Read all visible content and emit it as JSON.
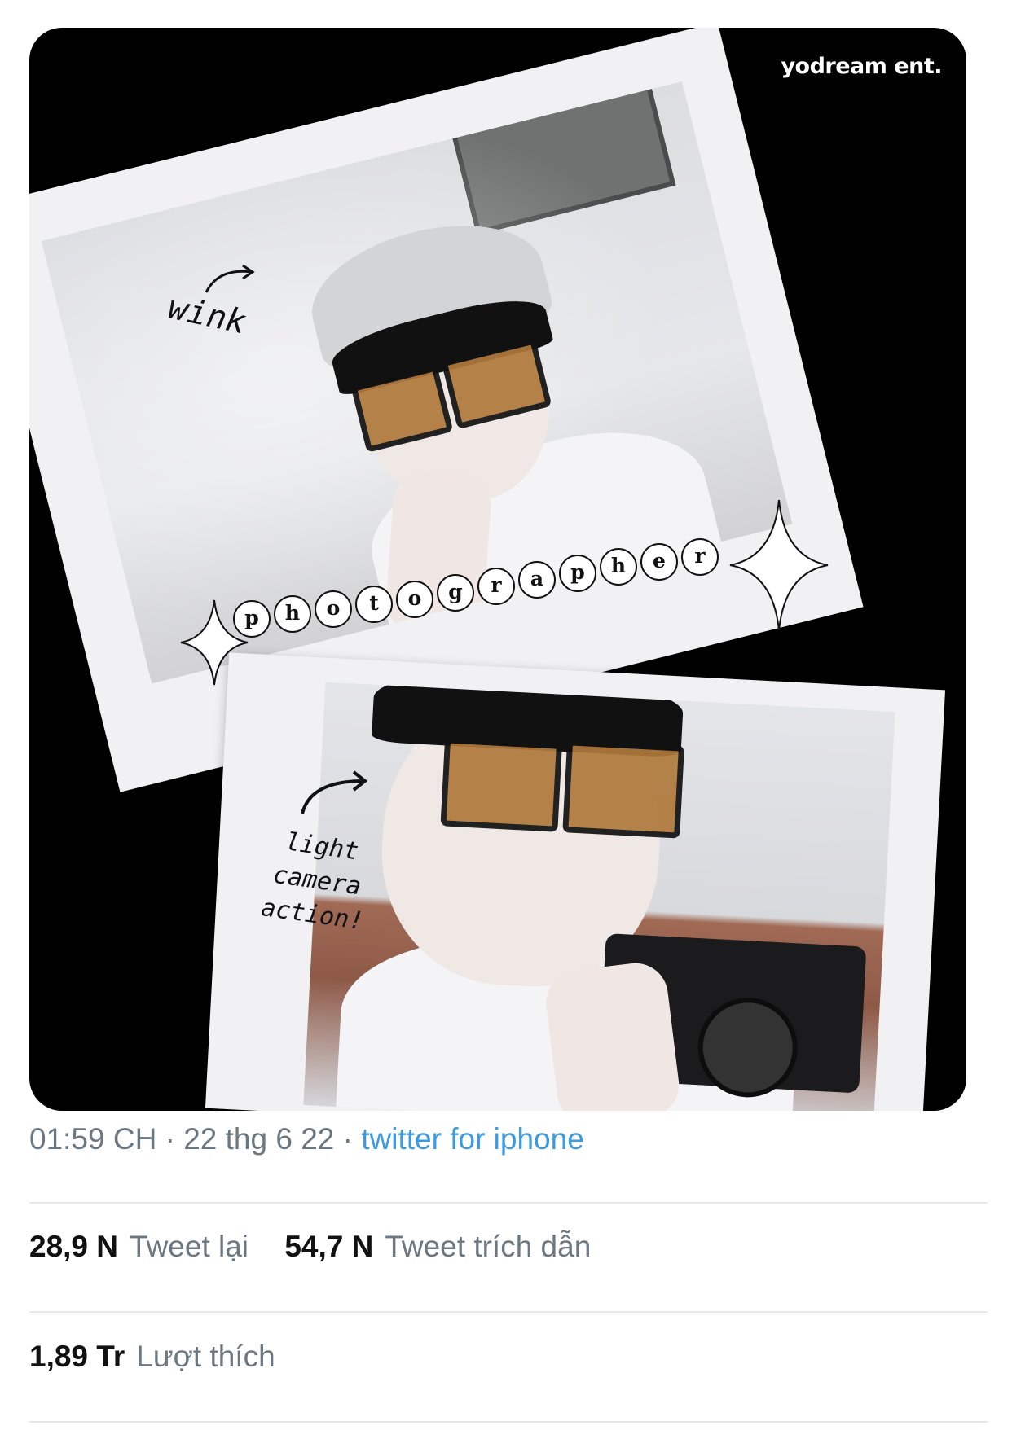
{
  "media": {
    "watermark": "yodream ent.",
    "annotations": {
      "wink": "wink",
      "light_lines": [
        "light",
        "camera",
        "action!"
      ]
    },
    "bubble_word": [
      "p",
      "h",
      "o",
      "t",
      "o",
      "g",
      "r",
      "a",
      "p",
      "h",
      "e",
      "r"
    ]
  },
  "tweet": {
    "time": "01:59 CH",
    "separator": "·",
    "date": "22 thg 6 22",
    "source": "twitter for iphone",
    "retweets_count": "28,9 N",
    "retweets_label": "Tweet lại",
    "quotes_count": "54,7 N",
    "quotes_label": "Tweet trích dẫn",
    "likes_count": "1,89 Tr",
    "likes_label": "Lượt thích"
  },
  "colors": {
    "link": "#3c9ae3",
    "muted": "#6b7781",
    "divider": "#e6e9ec"
  }
}
